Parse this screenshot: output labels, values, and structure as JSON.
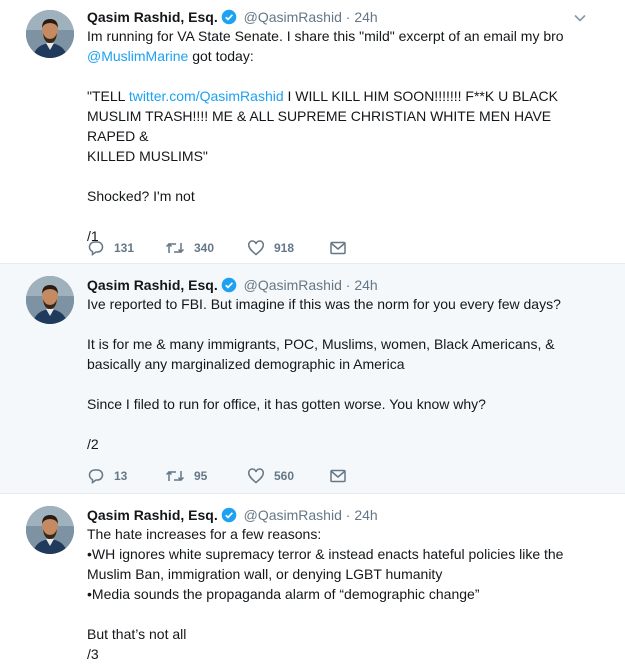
{
  "tweets": [
    {
      "author_name": "Qasim Rashid, Esq.",
      "handle": "@QasimRashid",
      "separator": "·",
      "time": "24h",
      "line1_pre": "Im running for VA State Senate. I share this \"mild\" excerpt of an email my bro",
      "mention": "@MuslimMarine",
      "line2_post": " got today:",
      "quote_pre": "\"TELL ",
      "quote_link": "twitter.com/QasimRashid",
      "quote_line1_post": " I WILL KILL HIM SOON!!!!!!! F**K U BLACK",
      "quote_line2": "MUSLIM TRASH!!!! ME & ALL SUPREME CHRISTIAN WHITE MEN HAVE RAPED &",
      "quote_line3": "KILLED MUSLIMS\"",
      "line_shocked": "Shocked? I'm not",
      "number": "/1",
      "replies": "131",
      "retweets": "340",
      "likes": "918"
    },
    {
      "author_name": "Qasim Rashid, Esq.",
      "handle": "@QasimRashid",
      "separator": "·",
      "time": "24h",
      "line1": "Ive reported to FBI. But imagine if this was the norm for you every few days?",
      "line2": "It is for me & many immigrants, POC, Muslims, women, Black Americans, &",
      "line3": "basically any marginalized demographic in America",
      "line4": "Since I filed to run for office, it has gotten worse. You know why?",
      "number": "/2",
      "replies": "13",
      "retweets": "95",
      "likes": "560"
    },
    {
      "author_name": "Qasim Rashid, Esq.",
      "handle": "@QasimRashid",
      "separator": "·",
      "time": "24h",
      "line1": "The hate increases for a few reasons:",
      "line2": "•WH ignores white supremacy terror & instead enacts hateful policies like the",
      "line3": "Muslim Ban, immigration wall, or denying LGBT humanity",
      "line4": "•Media sounds the propaganda alarm of “demographic change”",
      "line5": "But that’s not all",
      "number": "/3"
    }
  ],
  "icons": {
    "reply": "reply-icon",
    "retweet": "retweet-icon",
    "like": "heart-icon",
    "message": "envelope-icon",
    "verified": "verified-badge-icon",
    "caret": "chevron-down-icon"
  },
  "colors": {
    "link": "#1da1f2",
    "muted": "#657786",
    "verified": "#1da1f2",
    "thread_line": "#ccd6dd",
    "highlight_bg": "#f5f8fa"
  }
}
